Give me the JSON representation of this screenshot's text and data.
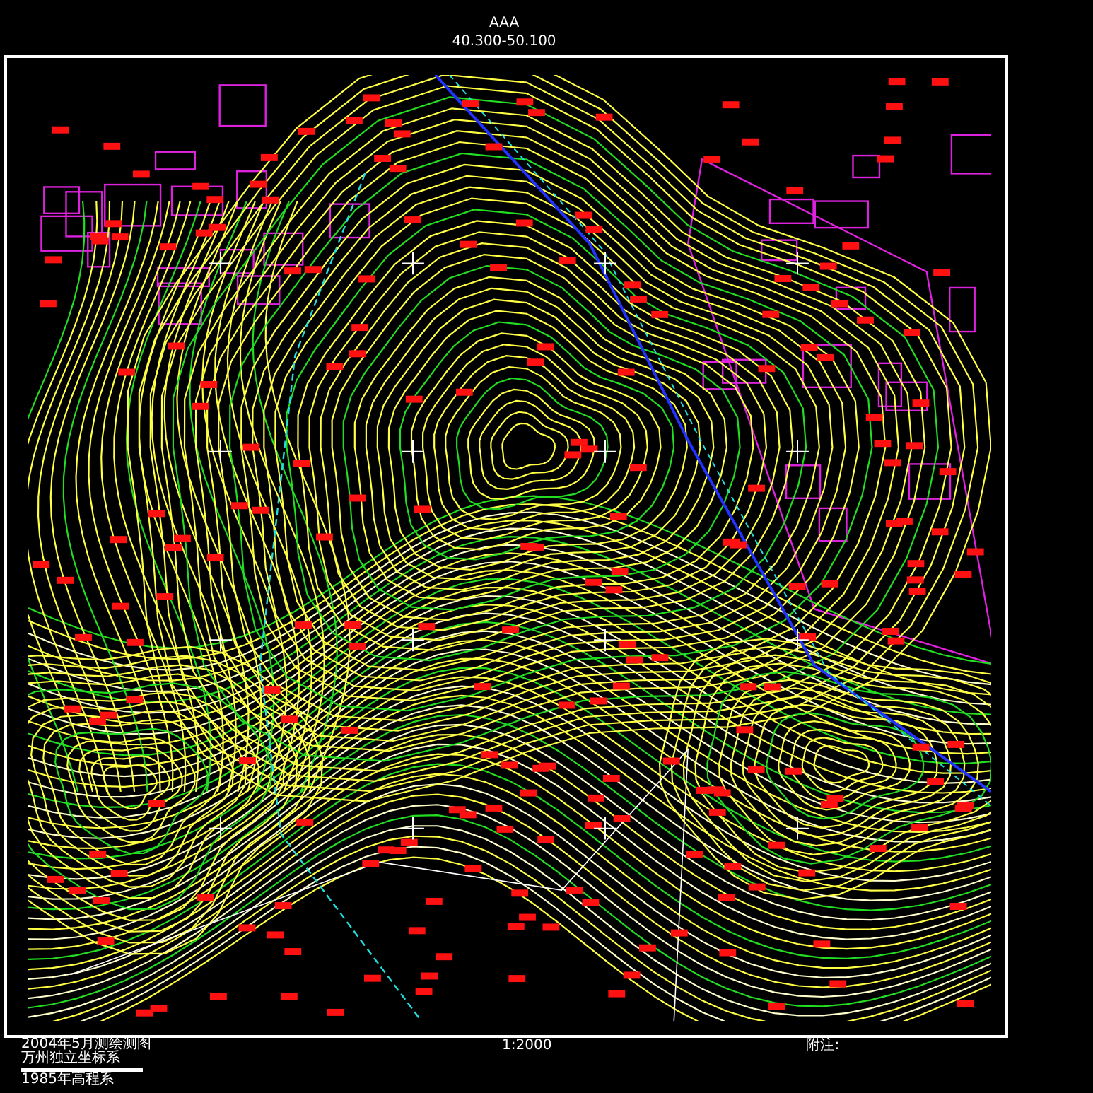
{
  "title": "AAA",
  "sheet_range": "40.300-50.100",
  "footer": {
    "survey_note": "2004年5月测绘测图",
    "coordinate_system": "万州独立坐标系",
    "elevation_system": "1985年高程系",
    "scale": "1:2000",
    "remarks_label": "附注:"
  }
}
